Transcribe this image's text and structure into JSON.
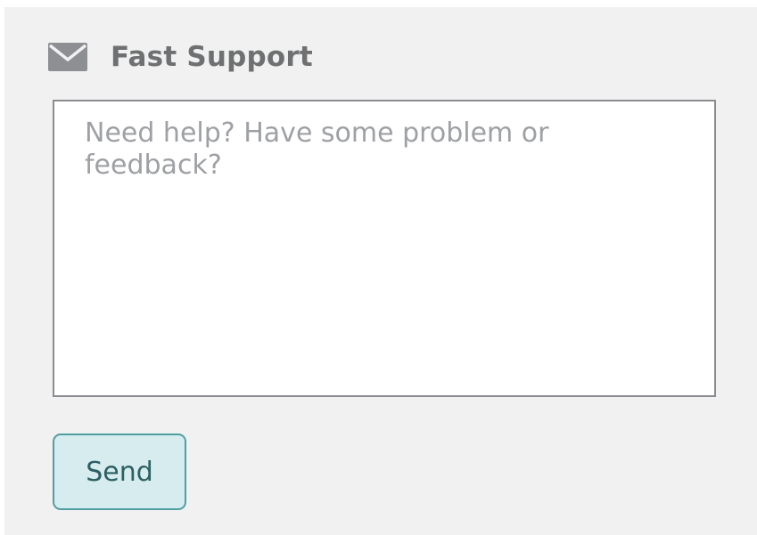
{
  "support": {
    "title": "Fast Support",
    "icon": "envelope-icon",
    "message_placeholder": "Need help? Have some problem or feedback?",
    "message_value": "",
    "send_label": "Send"
  },
  "colors": {
    "panel_bg": "#f1f1f1",
    "title": "#6f7072",
    "placeholder": "#9ea0a4",
    "button_bg": "#d6ecef",
    "button_border": "#4f9fa2",
    "button_text": "#2d5f63"
  }
}
